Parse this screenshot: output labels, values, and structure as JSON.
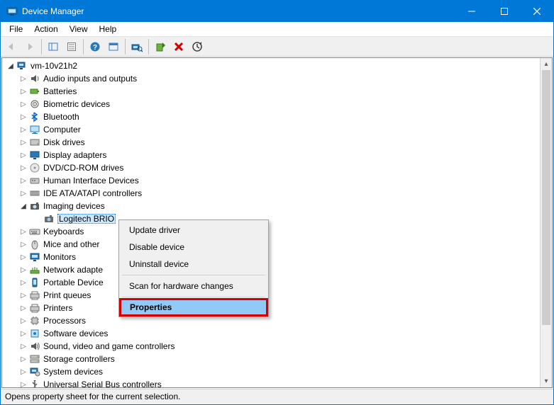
{
  "title": "Device Manager",
  "menus": [
    "File",
    "Action",
    "View",
    "Help"
  ],
  "root": "vm-10v21h2",
  "categories": [
    {
      "label": "Audio inputs and outputs",
      "icon": "audio"
    },
    {
      "label": "Batteries",
      "icon": "battery"
    },
    {
      "label": "Biometric devices",
      "icon": "biometric"
    },
    {
      "label": "Bluetooth",
      "icon": "bluetooth"
    },
    {
      "label": "Computer",
      "icon": "computer"
    },
    {
      "label": "Disk drives",
      "icon": "disk"
    },
    {
      "label": "Display adapters",
      "icon": "display"
    },
    {
      "label": "DVD/CD-ROM drives",
      "icon": "dvd"
    },
    {
      "label": "Human Interface Devices",
      "icon": "hid"
    },
    {
      "label": "IDE ATA/ATAPI controllers",
      "icon": "ide"
    },
    {
      "label": "Imaging devices",
      "icon": "imaging",
      "expanded": true,
      "children": [
        {
          "label": "Logitech BRIO",
          "icon": "camera"
        }
      ]
    },
    {
      "label": "Keyboards",
      "icon": "keyboard"
    },
    {
      "label": "Mice and other",
      "icon": "mouse"
    },
    {
      "label": "Monitors",
      "icon": "monitor"
    },
    {
      "label": "Network adapte",
      "icon": "network"
    },
    {
      "label": "Portable Device",
      "icon": "portable"
    },
    {
      "label": "Print queues",
      "icon": "printq"
    },
    {
      "label": "Printers",
      "icon": "printer"
    },
    {
      "label": "Processors",
      "icon": "cpu"
    },
    {
      "label": "Software devices",
      "icon": "software"
    },
    {
      "label": "Sound, video and game controllers",
      "icon": "sound"
    },
    {
      "label": "Storage controllers",
      "icon": "storage"
    },
    {
      "label": "System devices",
      "icon": "system"
    },
    {
      "label": "Universal Serial Bus controllers",
      "icon": "usb"
    }
  ],
  "context_menu": {
    "items": [
      {
        "label": "Update driver"
      },
      {
        "label": "Disable device"
      },
      {
        "label": "Uninstall device"
      },
      {
        "sep": true
      },
      {
        "label": "Scan for hardware changes"
      },
      {
        "sep": true
      },
      {
        "label": "Properties",
        "highlight": true
      }
    ]
  },
  "status": "Opens property sheet for the current selection."
}
